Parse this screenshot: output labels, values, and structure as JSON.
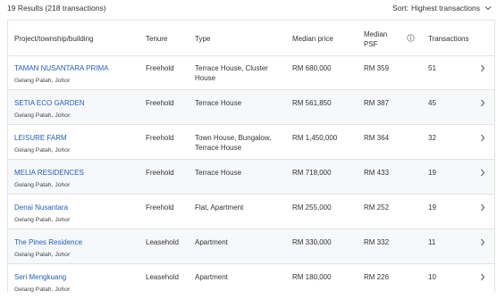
{
  "summary": {
    "results_text": "19 Results (218 transactions)"
  },
  "sort": {
    "label": "Sort:",
    "value": "Highest transactions"
  },
  "table": {
    "headers": {
      "project": "Project/township/building",
      "tenure": "Tenure",
      "type": "Type",
      "median_price": "Median price",
      "median_psf": "Median PSF",
      "transactions": "Transactions"
    },
    "rows": [
      {
        "name": "TAMAN NUSANTARA PRIMA",
        "location": "Gelang Patah, Johor",
        "tenure": "Freehold",
        "type": "Terrace House, Cluster House",
        "median_price": "RM 680,000",
        "median_psf": "RM 359",
        "transactions": "51"
      },
      {
        "name": "SETIA ECO GARDEN",
        "location": "Gelang Patah, Johor",
        "tenure": "Freehold",
        "type": "Terrace House",
        "median_price": "RM 561,850",
        "median_psf": "RM 387",
        "transactions": "45"
      },
      {
        "name": "LEISURE FARM",
        "location": "Gelang Patah, Johor",
        "tenure": "Freehold",
        "type": "Town House, Bungalow, Terrace House",
        "median_price": "RM 1,450,000",
        "median_psf": "RM 364",
        "transactions": "32"
      },
      {
        "name": "MELIA RESIDENCES",
        "location": "Gelang Patah, Johor",
        "tenure": "Freehold",
        "type": "Terrace House",
        "median_price": "RM 718,000",
        "median_psf": "RM 433",
        "transactions": "19"
      },
      {
        "name": "Denai Nusantara",
        "location": "Gelang Patah, Johor",
        "tenure": "Freehold",
        "type": "Flat, Apartment",
        "median_price": "RM 255,000",
        "median_psf": "RM 252",
        "transactions": "19"
      },
      {
        "name": "The Pines Residence",
        "location": "Gelang Patah, Johor",
        "tenure": "Leasehold",
        "type": "Apartment",
        "median_price": "RM 330,000",
        "median_psf": "RM 332",
        "transactions": "11"
      },
      {
        "name": "Seri Mengkuang",
        "location": "Gelang Patah, Johor",
        "tenure": "Leasehold",
        "type": "Apartment",
        "median_price": "RM 180,000",
        "median_psf": "RM 226",
        "transactions": "10"
      }
    ]
  },
  "icons": {
    "sort_caret": "chevron-down-icon",
    "info": "info-icon",
    "row_chevron": "chevron-right-icon"
  },
  "colors": {
    "link": "#1f5fbf",
    "alt_row": "#f7f8fa",
    "border": "#e3e3e3"
  }
}
